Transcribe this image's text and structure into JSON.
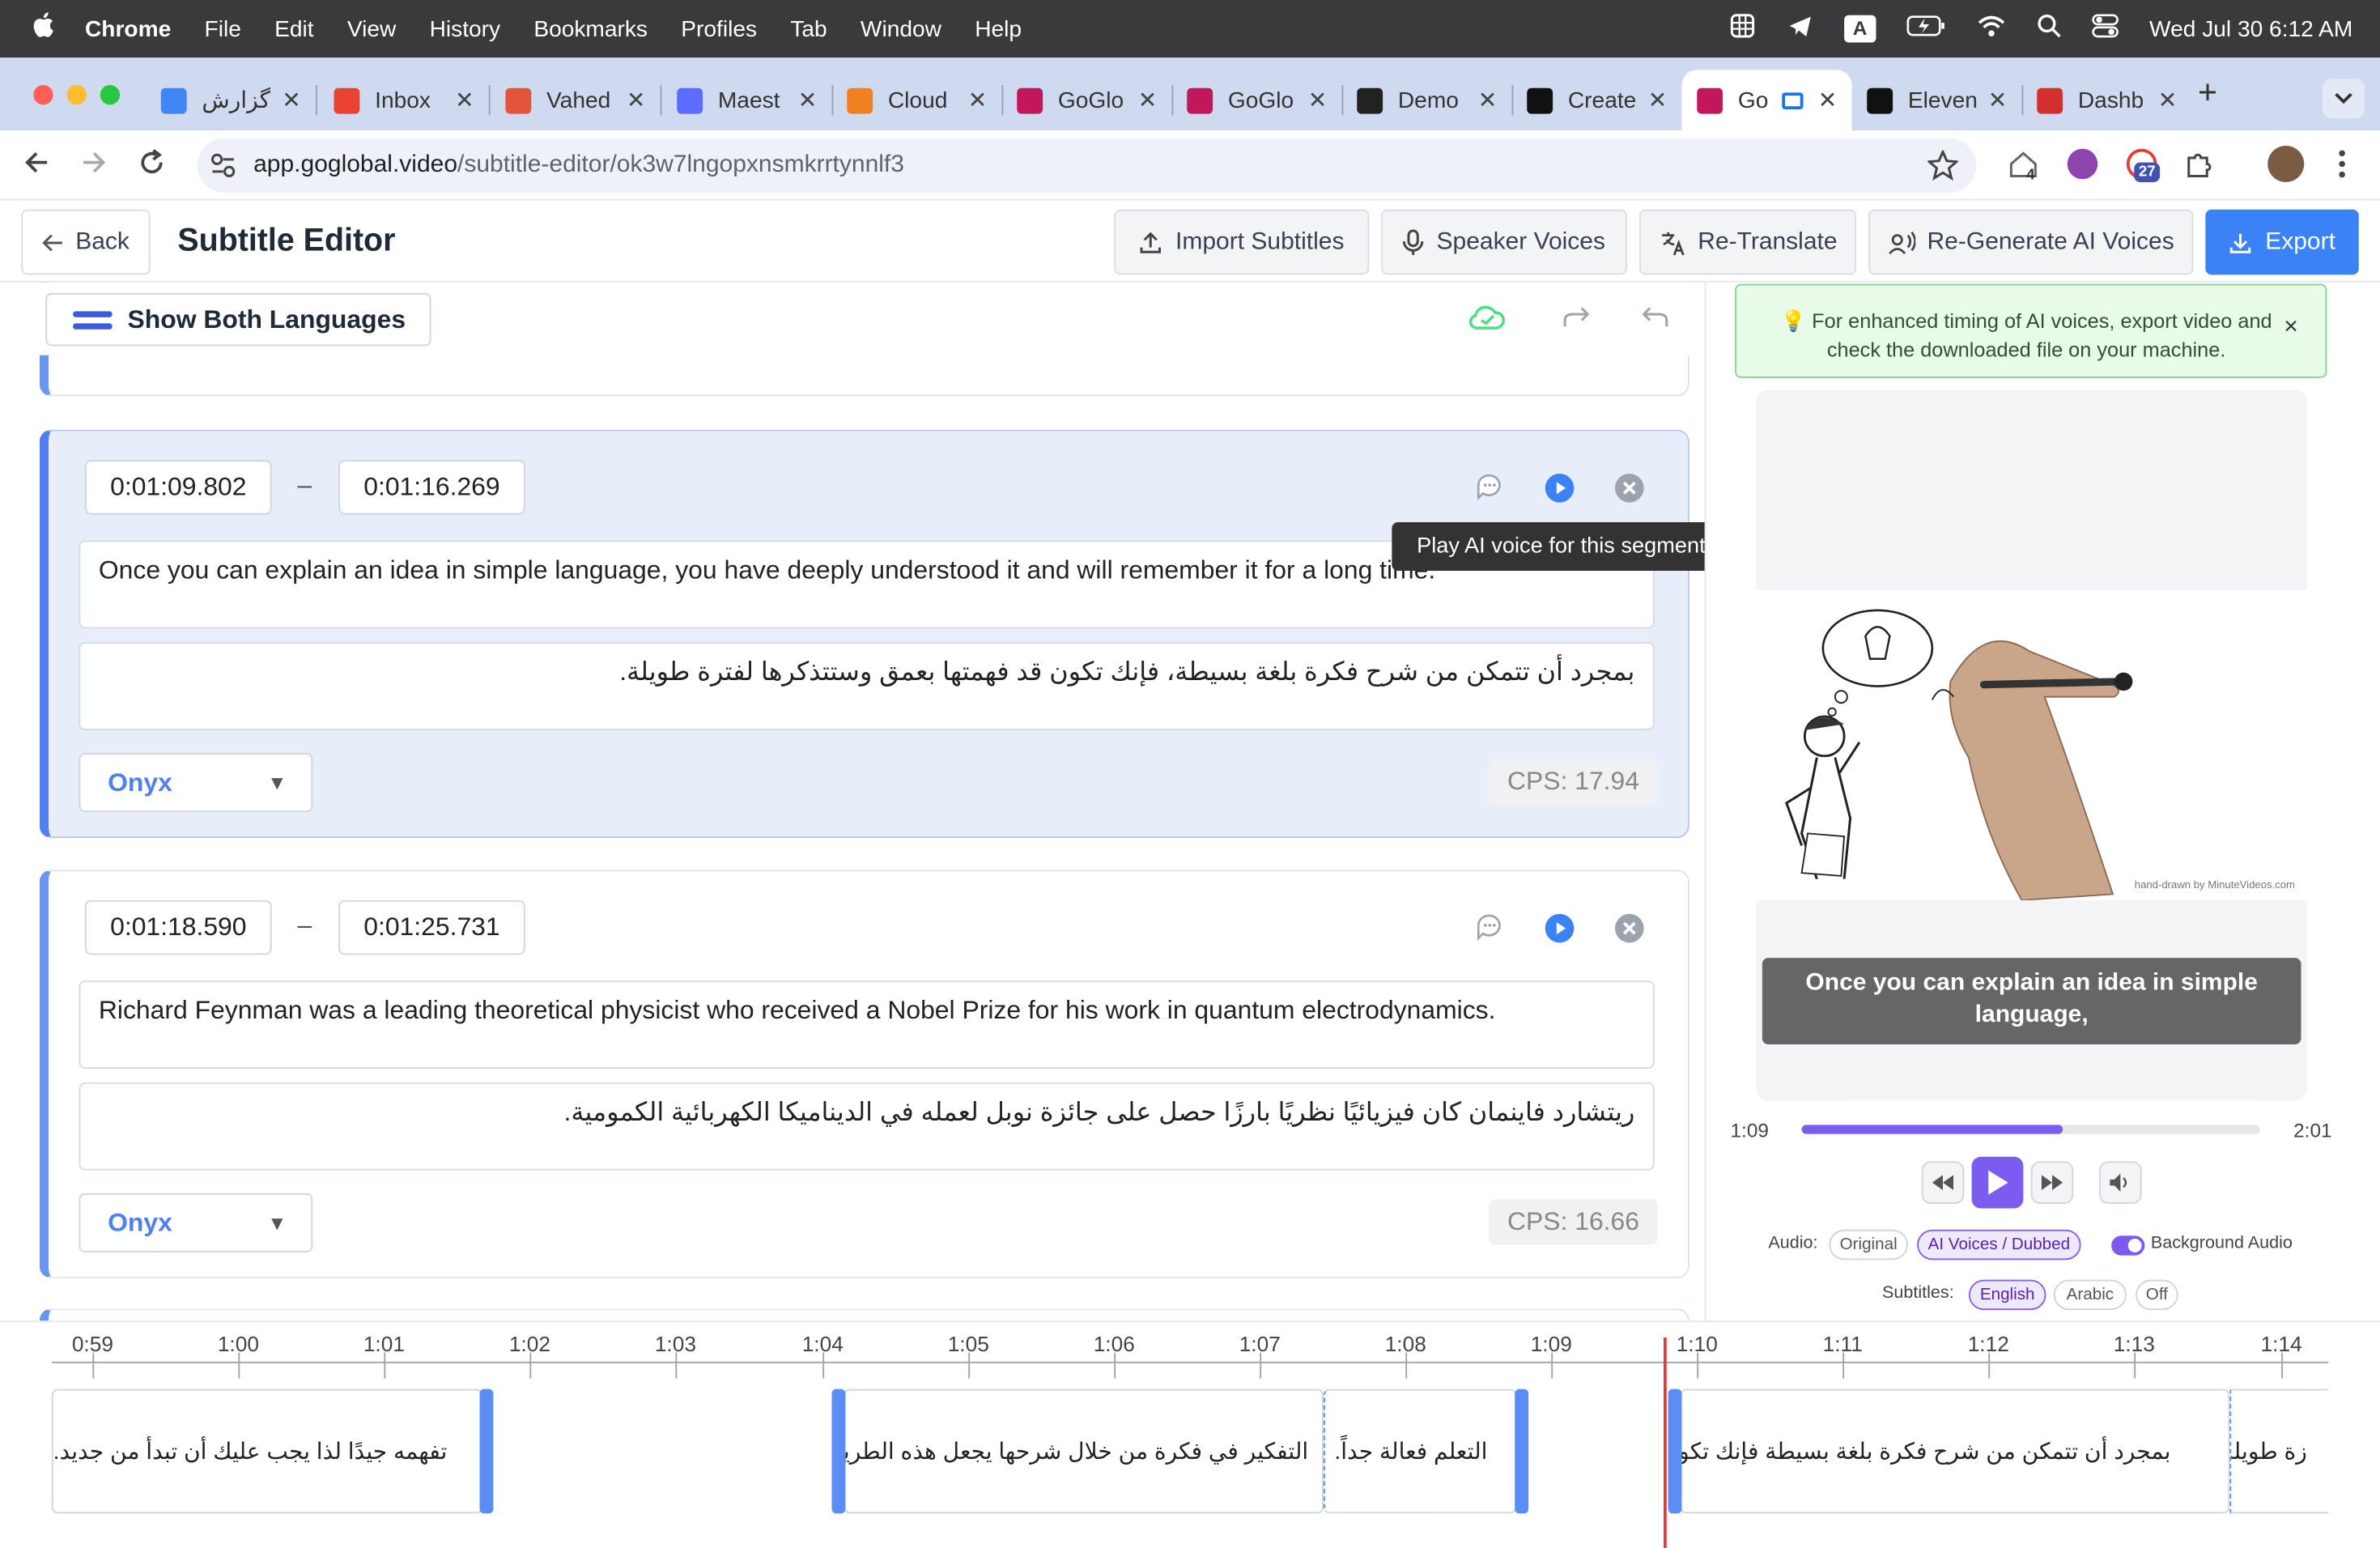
{
  "menubar": {
    "apple": "",
    "app": "Chrome",
    "items": [
      "File",
      "Edit",
      "View",
      "History",
      "Bookmarks",
      "Profiles",
      "Tab",
      "Window",
      "Help"
    ],
    "input_source": "A",
    "clock": "Wed Jul 30  6:12 AM"
  },
  "tabs": [
    {
      "title": "گزارش",
      "icon": "docs-icon",
      "color": "#4285f4"
    },
    {
      "title": "Inbox",
      "icon": "gmail-icon",
      "color": "#ea4335"
    },
    {
      "title": "Vahed",
      "icon": "p-icon",
      "color": "#e5533d"
    },
    {
      "title": "Maest",
      "icon": "maestra-icon",
      "color": "#5b6cff"
    },
    {
      "title": "Cloud",
      "icon": "cloudflare-icon",
      "color": "#f38020"
    },
    {
      "title": "GoGlo",
      "icon": "goglobal-icon",
      "color": "#c2185b"
    },
    {
      "title": "GoGlo",
      "icon": "goglobal-icon",
      "color": "#c2185b"
    },
    {
      "title": "Demo",
      "icon": "openai-icon",
      "color": "#222222"
    },
    {
      "title": "Create",
      "icon": "s-icon",
      "color": "#111111"
    },
    {
      "title": "Go",
      "icon": "goglobal-icon",
      "color": "#c2185b"
    },
    {
      "title": "Eleven",
      "icon": "s-icon",
      "color": "#111111"
    },
    {
      "title": "Dashb",
      "icon": "dashboard-icon",
      "color": "#d32f2f"
    }
  ],
  "address": {
    "domain": "app.goglobal.video",
    "path": "/subtitle-editor/ok3w7lngopxnsmkrrtynnlf3",
    "notif_badge_1": "4",
    "notif_badge_2": "27"
  },
  "header": {
    "back": "Back",
    "title": "Subtitle Editor",
    "import": "Import Subtitles",
    "speaker": "Speaker Voices",
    "retranslate": "Re-Translate",
    "regenerate": "Re-Generate AI Voices",
    "export": "Export"
  },
  "toolbar": {
    "show_both": "Show Both Languages"
  },
  "segments": [
    {
      "start": "0:01:09.802",
      "end": "0:01:16.269",
      "dash": "–",
      "english": "Once you can explain an idea in simple language, you have deeply understood it and will remember it for a long time.",
      "arabic": "بمجرد أن تتمكن من شرح فكرة بلغة بسيطة، فإنك تكون قد فهمتها بعمق وستتذكرها لفترة طويلة.",
      "voice": "Onyx",
      "cps": "CPS: 17.94"
    },
    {
      "start": "0:01:18.590",
      "end": "0:01:25.731",
      "dash": "–",
      "english": "Richard Feynman was a leading theoretical physicist who received a Nobel Prize for his work in quantum electrodynamics.",
      "arabic": "ريتشارد فاينمان كان فيزيائيًا نظريًا بارزًا حصل على جائزة نوبل لعمله في الديناميكا الكهربائية الكمومية.",
      "voice": "Onyx",
      "cps": "CPS: 16.66"
    }
  ],
  "tooltip": "Play AI voice for this segment",
  "preview": {
    "tip": "💡 For enhanced timing of AI voices, export video and check the downloaded file on your machine.",
    "close": "×",
    "watermark": "hand-drawn by MinuteVideos.com",
    "caption": "Once you can explain an idea in simple language,",
    "time_current": "1:09",
    "time_total": "2:01",
    "progress": 0.57,
    "audio_label": "Audio:",
    "audio_options": [
      "Original",
      "AI Voices / Dubbed"
    ],
    "background_audio": "Background Audio",
    "subtitles_label": "Subtitles:",
    "subtitle_options": [
      "English",
      "Arabic",
      "Off"
    ]
  },
  "timeline": {
    "ticks": [
      "0:59",
      "1:00",
      "1:01",
      "1:02",
      "1:03",
      "1:04",
      "1:05",
      "1:06",
      "1:07",
      "1:08",
      "1:09",
      "1:10",
      "1:11",
      "1:12",
      "1:13",
      "1:14"
    ],
    "clips": [
      "تفهمه جيدًا لذا يجب عليك أن تبدأ من جديد.",
      "التفكير في فكرة من خلال شرحها يجعل هذه الطريقة في",
      "التعلم فعالة جداً.",
      "بمجرد أن تتمكن من شرح فكرة بلغة بسيطة فإنك تكون",
      "زة طويلة."
    ]
  },
  "colors": {
    "accent": "#3b82f6",
    "purple": "#7c5cf0",
    "playhead": "#e53935",
    "tip_bg": "#e8fbe9"
  }
}
